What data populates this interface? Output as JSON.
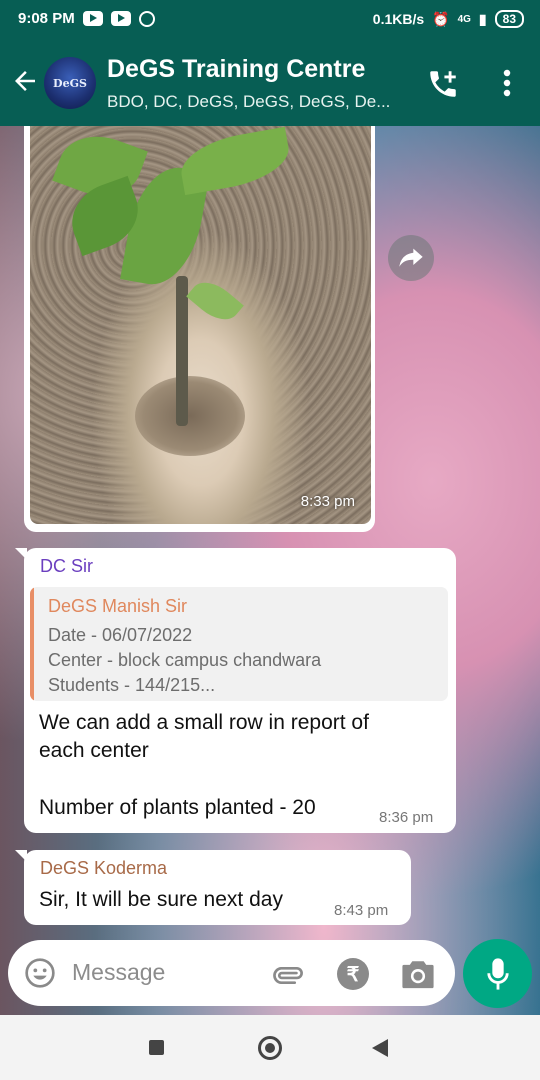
{
  "status": {
    "time": "9:08 PM",
    "speed": "0.1KB/s",
    "network": "4G",
    "battery": "83"
  },
  "header": {
    "title": "DeGS Training Centre",
    "subtitle": "BDO, DC, DeGS, DeGS, DeGS, De...",
    "avatar_text": "DeGS"
  },
  "messages": {
    "image": {
      "time": "8:33 pm"
    },
    "m1": {
      "sender": "DC Sir",
      "quote": {
        "author": "DeGS Manish Sir",
        "line1": "Date - 06/07/2022",
        "line2": "Center - block campus chandwara",
        "line3": "Students - 144/215..."
      },
      "text1": "We can add a small row in report of",
      "text2": "each center",
      "text3": "Number of plants planted - 20",
      "time": "8:36 pm"
    },
    "m2": {
      "sender": "DeGS Koderma",
      "text": "Sir, It will be sure next day",
      "time": "8:43 pm"
    }
  },
  "composer": {
    "placeholder": "Message",
    "rupee": "₹"
  },
  "colors": {
    "header": "#075e54",
    "accent": "#00a884",
    "sender1": "#6b3fbf",
    "sender2": "#a86a48",
    "quote_author": "#e0885d"
  }
}
